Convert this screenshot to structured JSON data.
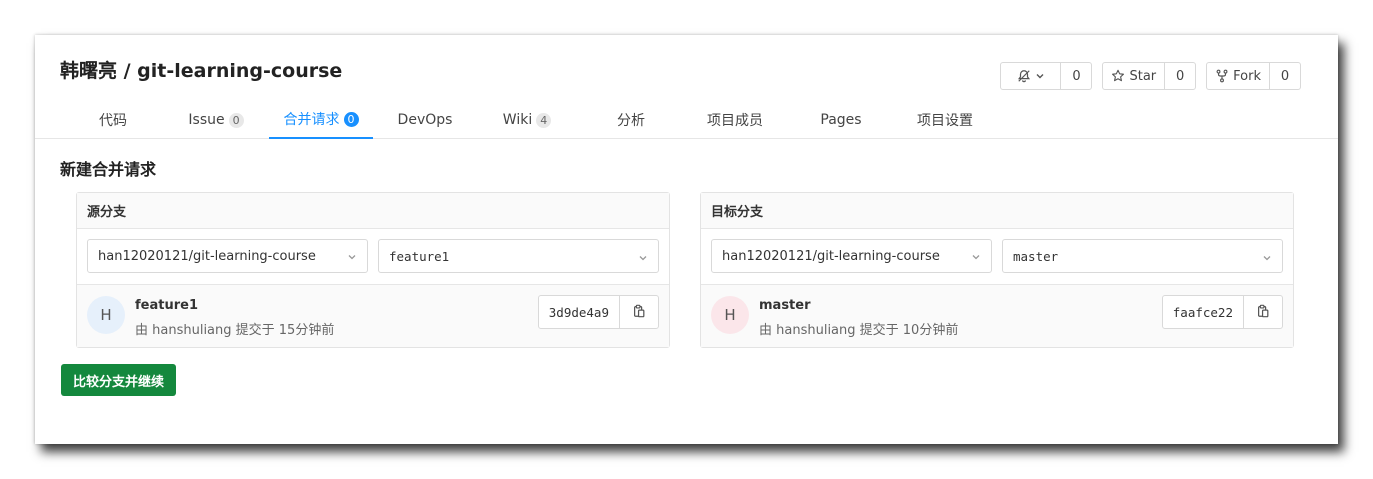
{
  "header": {
    "title": "韩曙亮 / git-learning-course",
    "watch": {
      "icon": "bell-slash-icon",
      "count": "0"
    },
    "star": {
      "icon": "star-icon",
      "label": "Star",
      "count": "0"
    },
    "fork": {
      "icon": "fork-icon",
      "label": "Fork",
      "count": "0"
    }
  },
  "tabs": [
    {
      "label": "代码",
      "badge": null
    },
    {
      "label": "Issue",
      "badge": "0"
    },
    {
      "label": "合并请求",
      "badge": "0",
      "active": true
    },
    {
      "label": "DevOps",
      "badge": null
    },
    {
      "label": "Wiki",
      "badge": "4"
    },
    {
      "label": "分析",
      "badge": null
    },
    {
      "label": "项目成员",
      "badge": null
    },
    {
      "label": "Pages",
      "badge": null
    },
    {
      "label": "项目设置",
      "badge": null
    }
  ],
  "page": {
    "title": "新建合并请求",
    "submit_label": "比较分支并继续"
  },
  "source": {
    "heading": "源分支",
    "repo": "han12020121/git-learning-course",
    "branch": "feature1",
    "avatar_letter": "H",
    "commit_branch": "feature1",
    "commit_meta": "由 hanshuliang 提交于 15分钟前",
    "sha": "3d9de4a9",
    "avatar_color": "#e6f0fb"
  },
  "target": {
    "heading": "目标分支",
    "repo": "han12020121/git-learning-course",
    "branch": "master",
    "avatar_letter": "H",
    "commit_branch": "master",
    "commit_meta": "由 hanshuliang 提交于 10分钟前",
    "sha": "faafce22",
    "avatar_color": "#fbe6ea"
  },
  "colors": {
    "accent": "#1890ff",
    "submit": "#14883d"
  }
}
